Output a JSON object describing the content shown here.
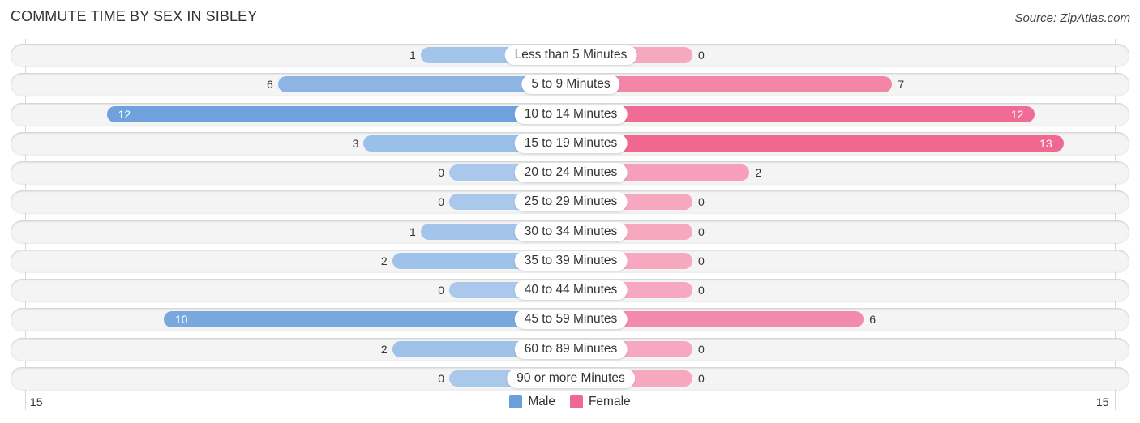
{
  "header": {
    "title": "COMMUTE TIME BY SEX IN SIBLEY",
    "source": "Source: ZipAtlas.com"
  },
  "colors": {
    "male": "#6a9fdb",
    "female": "#f06791",
    "male_light": "#a9c8ec",
    "female_light": "#f7a8c1"
  },
  "legend": [
    {
      "name": "Male",
      "color": "#6a9fdb"
    },
    {
      "name": "Female",
      "color": "#f06791"
    }
  ],
  "axis": {
    "left_tick": "15",
    "right_tick": "15"
  },
  "chart_data": {
    "type": "bar",
    "orientation": "horizontal-diverging",
    "title": "COMMUTE TIME BY SEX IN SIBLEY",
    "categories": [
      "Less than 5 Minutes",
      "5 to 9 Minutes",
      "10 to 14 Minutes",
      "15 to 19 Minutes",
      "20 to 24 Minutes",
      "25 to 29 Minutes",
      "30 to 34 Minutes",
      "35 to 39 Minutes",
      "40 to 44 Minutes",
      "45 to 59 Minutes",
      "60 to 89 Minutes",
      "90 or more Minutes"
    ],
    "series": [
      {
        "name": "Male",
        "values": [
          1,
          6,
          12,
          3,
          0,
          0,
          1,
          2,
          0,
          10,
          2,
          0
        ]
      },
      {
        "name": "Female",
        "values": [
          0,
          7,
          12,
          13,
          2,
          0,
          0,
          0,
          0,
          6,
          0,
          0
        ]
      }
    ],
    "xlim": [
      -15,
      15
    ],
    "xticks": [
      "15",
      "15"
    ],
    "legend_position": "bottom-center",
    "grid": false
  }
}
